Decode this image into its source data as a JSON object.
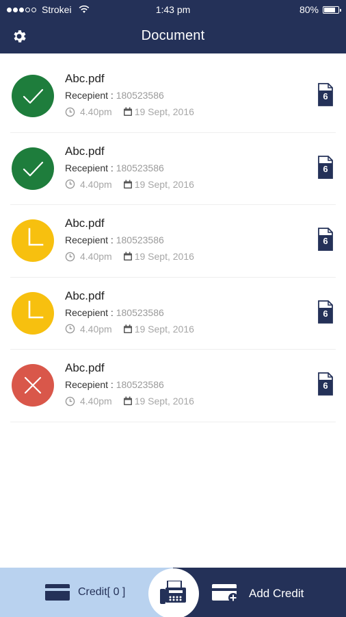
{
  "status_bar": {
    "carrier": "Strokei",
    "time": "1:43 pm",
    "battery": "80%",
    "battery_level": 0.8,
    "signal_bars_filled": 3,
    "signal_bars_total": 5
  },
  "header": {
    "title": "Document",
    "settings_icon": "gear-icon"
  },
  "documents": [
    {
      "name": "Abc.pdf",
      "recipient_label": "Recepient :",
      "recipient": "180523586",
      "time": "4.40pm",
      "date": "19 Sept, 2016",
      "pages": "6",
      "status": "success",
      "status_color": "#1e7d3c"
    },
    {
      "name": "Abc.pdf",
      "recipient_label": "Recepient :",
      "recipient": "180523586",
      "time": "4.40pm",
      "date": "19 Sept, 2016",
      "pages": "6",
      "status": "success",
      "status_color": "#1e7d3c"
    },
    {
      "name": "Abc.pdf",
      "recipient_label": "Recepient :",
      "recipient": "180523586",
      "time": "4.40pm",
      "date": "19 Sept, 2016",
      "pages": "6",
      "status": "pending",
      "status_color": "#f7c00f"
    },
    {
      "name": "Abc.pdf",
      "recipient_label": "Recepient :",
      "recipient": "180523586",
      "time": "4.40pm",
      "date": "19 Sept, 2016",
      "pages": "6",
      "status": "pending",
      "status_color": "#f7c00f"
    },
    {
      "name": "Abc.pdf",
      "recipient_label": "Recepient :",
      "recipient": "180523586",
      "time": "4.40pm",
      "date": "19 Sept, 2016",
      "pages": "6",
      "status": "failed",
      "status_color": "#d9574a"
    }
  ],
  "bottom_bar": {
    "credit_label": "Credit[ 0 ]",
    "add_credit_label": "Add Credit",
    "fax_icon": "fax-icon"
  },
  "colors": {
    "primary": "#243158",
    "light_blue": "#b9d2ef",
    "muted_text": "#a6a6a6"
  }
}
